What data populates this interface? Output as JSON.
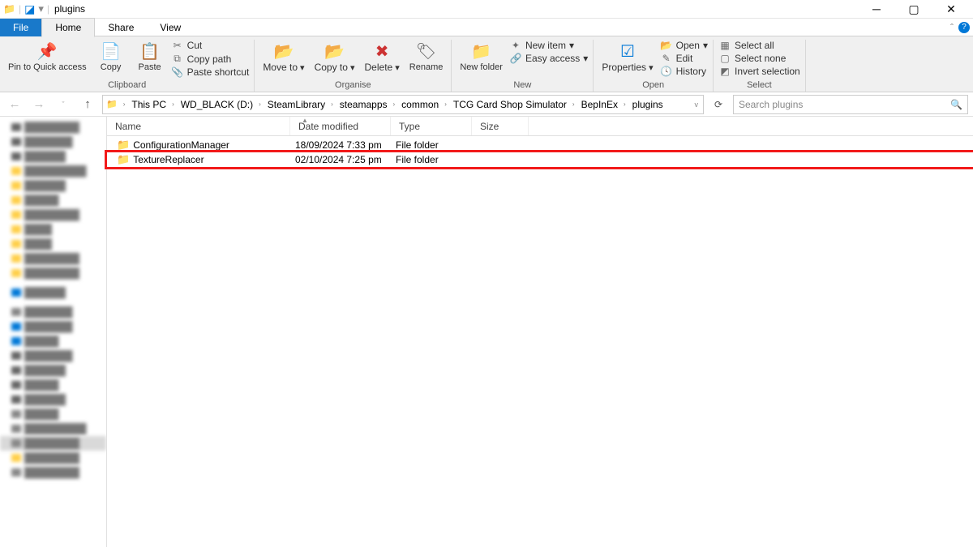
{
  "title": "plugins",
  "tabs": {
    "file": "File",
    "home": "Home",
    "share": "Share",
    "view": "View"
  },
  "ribbon": {
    "clipboard": {
      "pin": "Pin to Quick access",
      "copy": "Copy",
      "paste": "Paste",
      "cut": "Cut",
      "copypath": "Copy path",
      "pasteshort": "Paste shortcut",
      "label": "Clipboard"
    },
    "organise": {
      "moveto": "Move to",
      "copyto": "Copy to",
      "delete": "Delete",
      "rename": "Rename",
      "label": "Organise"
    },
    "new": {
      "newfolder": "New folder",
      "newitem": "New item",
      "easyaccess": "Easy access",
      "label": "New"
    },
    "open": {
      "properties": "Properties",
      "open": "Open",
      "edit": "Edit",
      "history": "History",
      "label": "Open"
    },
    "select": {
      "selectall": "Select all",
      "selectnone": "Select none",
      "invert": "Invert selection",
      "label": "Select"
    }
  },
  "breadcrumb": [
    "This PC",
    "WD_BLACK (D:)",
    "SteamLibrary",
    "steamapps",
    "common",
    "TCG Card Shop Simulator",
    "BepInEx",
    "plugins"
  ],
  "search_placeholder": "Search plugins",
  "columns": {
    "name": "Name",
    "date": "Date modified",
    "type": "Type",
    "size": "Size"
  },
  "files": [
    {
      "name": "ConfigurationManager",
      "date": "18/09/2024 7:33 pm",
      "type": "File folder",
      "size": ""
    },
    {
      "name": "TextureReplacer",
      "date": "02/10/2024 7:25 pm",
      "type": "File folder",
      "size": ""
    }
  ],
  "highlight_index": 1
}
